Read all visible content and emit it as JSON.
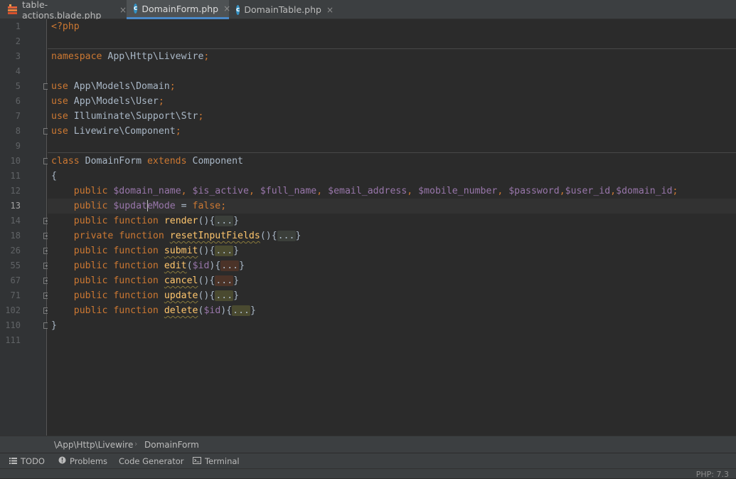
{
  "tabs": [
    {
      "label": "table-actions.blade.php",
      "icon": "blade-icon",
      "active": false
    },
    {
      "label": "DomainForm.php",
      "icon": "php-class-icon",
      "active": true
    },
    {
      "label": "DomainTable.php",
      "icon": "php-class-icon",
      "active": false
    }
  ],
  "close_glyph": "×",
  "class_icon_letter": "c",
  "line_numbers": [
    "1",
    "2",
    "3",
    "4",
    "5",
    "6",
    "7",
    "8",
    "9",
    "10",
    "11",
    "12",
    "13",
    "14",
    "18",
    "26",
    "55",
    "67",
    "71",
    "102",
    "110",
    "111"
  ],
  "current_line": "13",
  "code": {
    "l1": "<?php",
    "l3_kw": "namespace",
    "l3_rest": " App\\Http\\Livewire",
    "semicolon": ";",
    "use_kw": "use",
    "l5": " App\\Models\\Domain",
    "l6": " App\\Models\\User",
    "l7": " Illuminate\\Support\\Str",
    "l8": " Livewire\\Component",
    "class_kw": "class",
    "class_name": " DomainForm ",
    "extends_kw": "extends",
    "parent": " Component",
    "brace_open": "{",
    "brace_close": "}",
    "public_kw": "public",
    "private_kw": "private",
    "function_kw": "function",
    "props": [
      "$domain_name",
      "$is_active",
      "$full_name",
      "$email_address",
      "$mobile_number",
      "$password",
      "$user_id",
      "$domain_id"
    ],
    "update_mode_a": "$updat",
    "update_mode_b": "eMode",
    "eq": " = ",
    "false_kw": "false",
    "fn_render": "render",
    "fn_reset": "resetInputFields",
    "fn_submit": "submit",
    "fn_edit": "edit",
    "fn_cancel": "cancel",
    "fn_update": "update",
    "fn_delete": "delete",
    "param_id": "$id",
    "folded": "...",
    "parens": "()",
    "paren_open": "(",
    "paren_close": ")",
    "comma": ", ",
    "comma_tight": ","
  },
  "breadcrumb": {
    "namespace": "\\App\\Http\\Livewire",
    "class": "DomainForm",
    "separator": "›"
  },
  "toolwindows": [
    {
      "label": "TODO",
      "icon": "todo-list-icon"
    },
    {
      "label": "Problems",
      "icon": "problems-icon"
    },
    {
      "label": "Code Generator",
      "icon": ""
    },
    {
      "label": "Terminal",
      "icon": "terminal-icon"
    }
  ],
  "status": {
    "php_version": "PHP: 7.3"
  },
  "colors": {
    "background": "#2b2b2b",
    "keyword": "#cc7832",
    "variable": "#9876aa",
    "function": "#ffc66d",
    "text": "#a9b7c6",
    "accent": "#4a88c7"
  }
}
